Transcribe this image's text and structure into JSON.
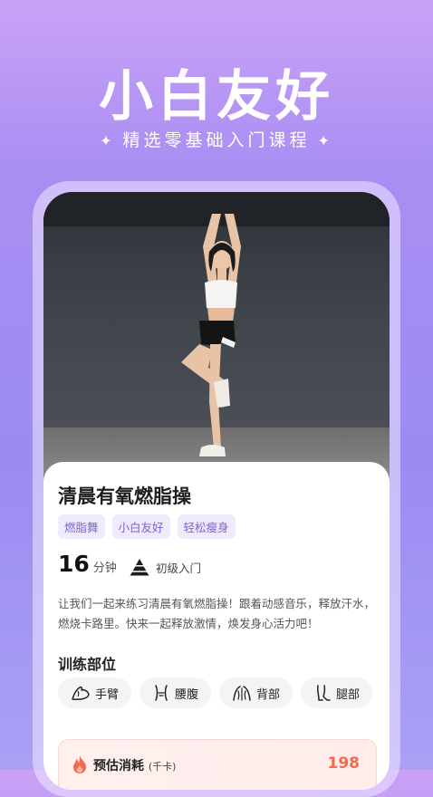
{
  "hero": {
    "title": "小白友好",
    "subtitle": "精选零基础入门课程",
    "sparkle": "✦"
  },
  "course": {
    "title": "清晨有氧燃脂操",
    "tags": [
      "燃脂舞",
      "小白友好",
      "轻松瘦身"
    ],
    "duration_value": "16",
    "duration_unit": "分钟",
    "level": "初级入门",
    "description": "让我们一起来练习清晨有氧燃脂操！跟着动感音乐，释放汗水，燃烧卡路里。快来一起释放激情，焕发身心活力吧！",
    "body_parts_title": "训练部位",
    "body_parts": [
      {
        "label": "手臂",
        "icon": "arm-icon"
      },
      {
        "label": "腰腹",
        "icon": "waist-icon"
      },
      {
        "label": "背部",
        "icon": "back-icon"
      },
      {
        "label": "腿部",
        "icon": "leg-icon"
      }
    ],
    "calorie_label": "预估消耗",
    "calorie_unit": "(千卡)",
    "calorie_value": "198"
  },
  "colors": {
    "accent": "#7c63d8",
    "tag_bg": "#efebfc",
    "calorie": "#f36a4f"
  }
}
